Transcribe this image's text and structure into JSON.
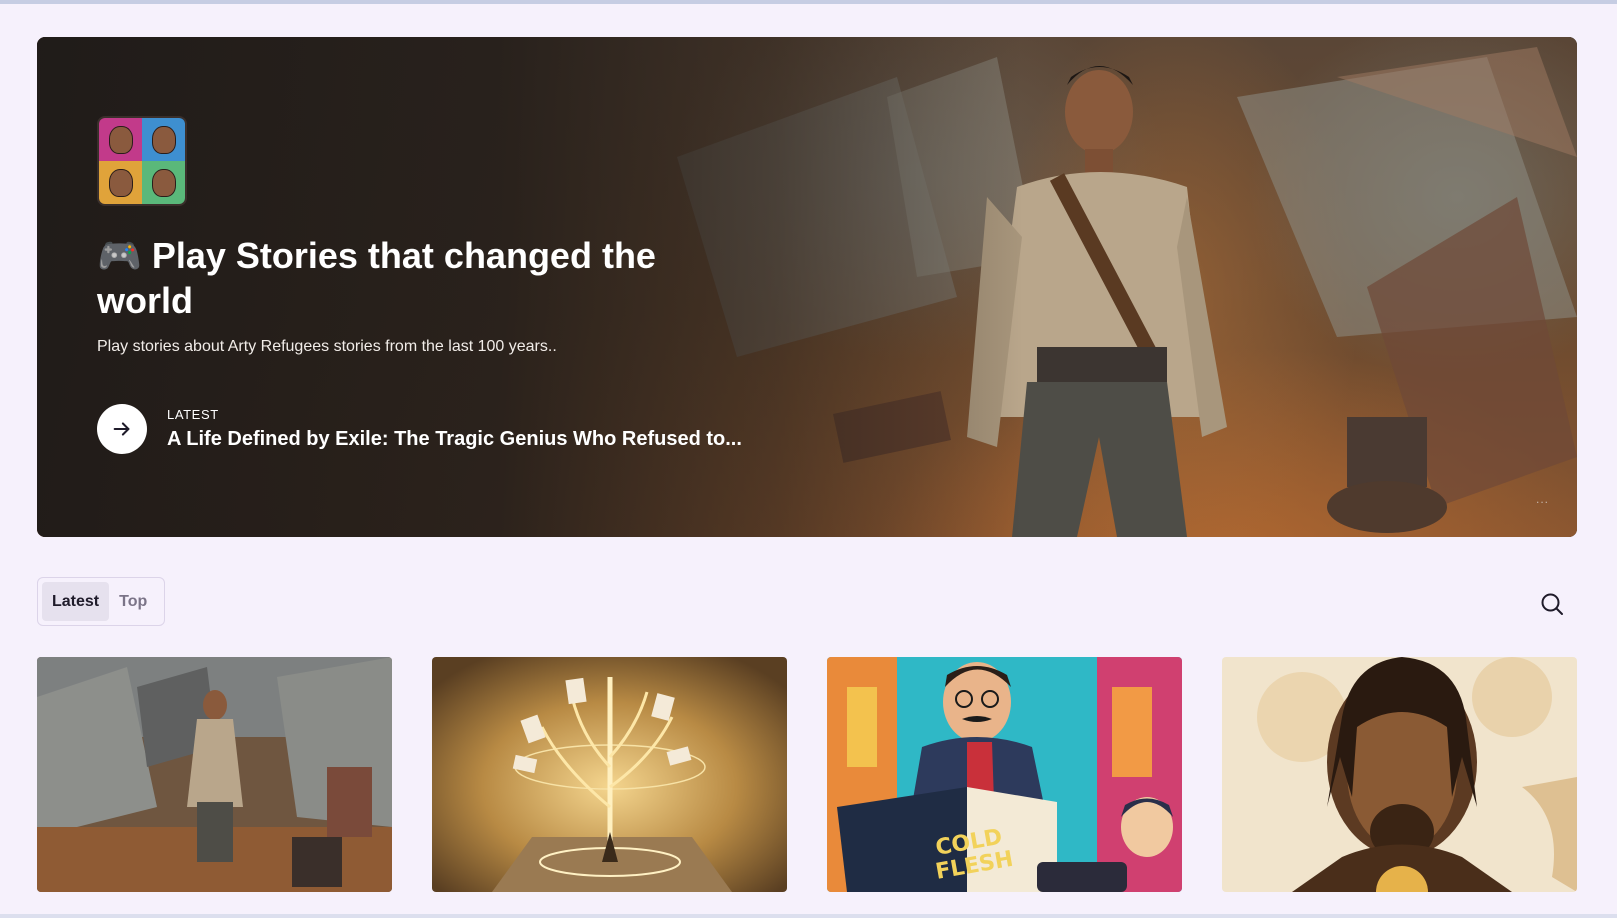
{
  "hero": {
    "title": "🎮 Play Stories that changed the world",
    "subtitle": "Play stories about Arty Refugees stories from the last 100 years..",
    "latest_label": "LATEST",
    "latest_title": "A Life Defined by Exile: The Tragic Genius Who Refused to...",
    "more_indicator": "..."
  },
  "tabs": [
    {
      "label": "Latest",
      "active": true
    },
    {
      "label": "Top",
      "active": false
    }
  ],
  "cards": [
    {
      "image": "refugee-man-in-tent-camp"
    },
    {
      "image": "golden-tree-pen-with-cards"
    },
    {
      "image": "man-reading-cold-flesh-book",
      "book_title_line1": "COLD",
      "book_title_line2": "FLESH"
    },
    {
      "image": "man-with-dreadlocks-portrait"
    }
  ],
  "icons": {
    "arrow": "arrow-right-icon",
    "search": "search-icon"
  },
  "colors": {
    "background": "#f6f1fc",
    "tab_active_bg": "#e6e1ee",
    "hero_text": "#ffffff"
  }
}
